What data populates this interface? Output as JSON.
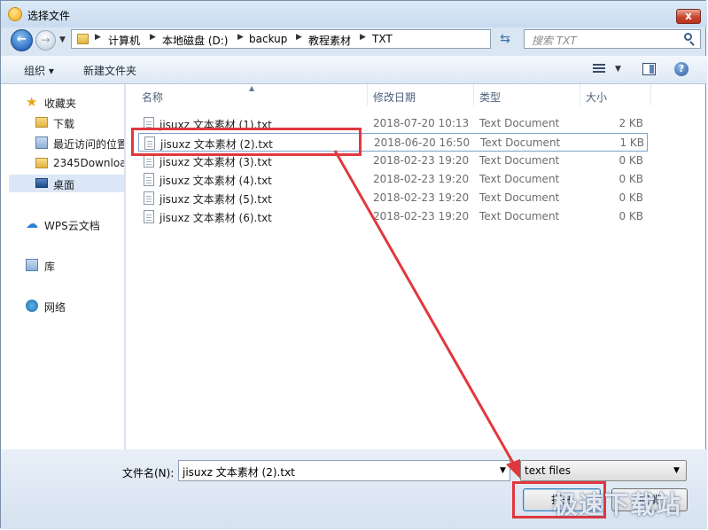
{
  "window": {
    "title": "选择文件",
    "close_label": "x"
  },
  "nav": {
    "back_label": "←",
    "forward_label": "→"
  },
  "address": {
    "crumbs": [
      "计算机",
      "本地磁盘 (D:)",
      "backup",
      "教程素材",
      "TXT"
    ]
  },
  "search": {
    "placeholder": "搜索 TXT"
  },
  "toolbar": {
    "organize": "组织 ▾",
    "new_folder": "新建文件夹",
    "help": "?"
  },
  "sidebar": {
    "items": [
      {
        "label": "收藏夹",
        "icon": "star-icon"
      },
      {
        "label": "下载",
        "icon": "download-folder-icon"
      },
      {
        "label": "最近访问的位置",
        "icon": "recent-places-icon"
      },
      {
        "label": "2345Downloads",
        "icon": "folder-icon"
      },
      {
        "label": "桌面",
        "icon": "desktop-icon",
        "selected": true
      },
      {
        "label": "WPS云文档",
        "icon": "cloud-icon"
      },
      {
        "label": "库",
        "icon": "library-icon"
      },
      {
        "label": "网络",
        "icon": "network-icon"
      }
    ]
  },
  "columns": {
    "name": "名称",
    "date": "修改日期",
    "type": "类型",
    "size": "大小"
  },
  "files": [
    {
      "name": "jisuxz 文本素材 (1).txt",
      "date": "2018-07-20 10:13",
      "type": "Text Document",
      "size": "2 KB"
    },
    {
      "name": "jisuxz 文本素材 (2).txt",
      "date": "2018-06-20 16:50",
      "type": "Text Document",
      "size": "1 KB",
      "selected": true
    },
    {
      "name": "jisuxz 文本素材 (3).txt",
      "date": "2018-02-23 19:20",
      "type": "Text Document",
      "size": "0 KB"
    },
    {
      "name": "jisuxz 文本素材 (4).txt",
      "date": "2018-02-23 19:20",
      "type": "Text Document",
      "size": "0 KB"
    },
    {
      "name": "jisuxz 文本素材 (5).txt",
      "date": "2018-02-23 19:20",
      "type": "Text Document",
      "size": "0 KB"
    },
    {
      "name": "jisuxz 文本素材 (6).txt",
      "date": "2018-02-23 19:20",
      "type": "Text Document",
      "size": "0 KB"
    }
  ],
  "footer": {
    "filename_label": "文件名(N):",
    "filename_value": "jisuxz 文本素材 (2).txt",
    "filetype_value": "text files",
    "open_label": "打开",
    "cancel_label": "取消"
  },
  "annotation": {
    "color": "#e0383e"
  },
  "watermark": "极速下载站"
}
